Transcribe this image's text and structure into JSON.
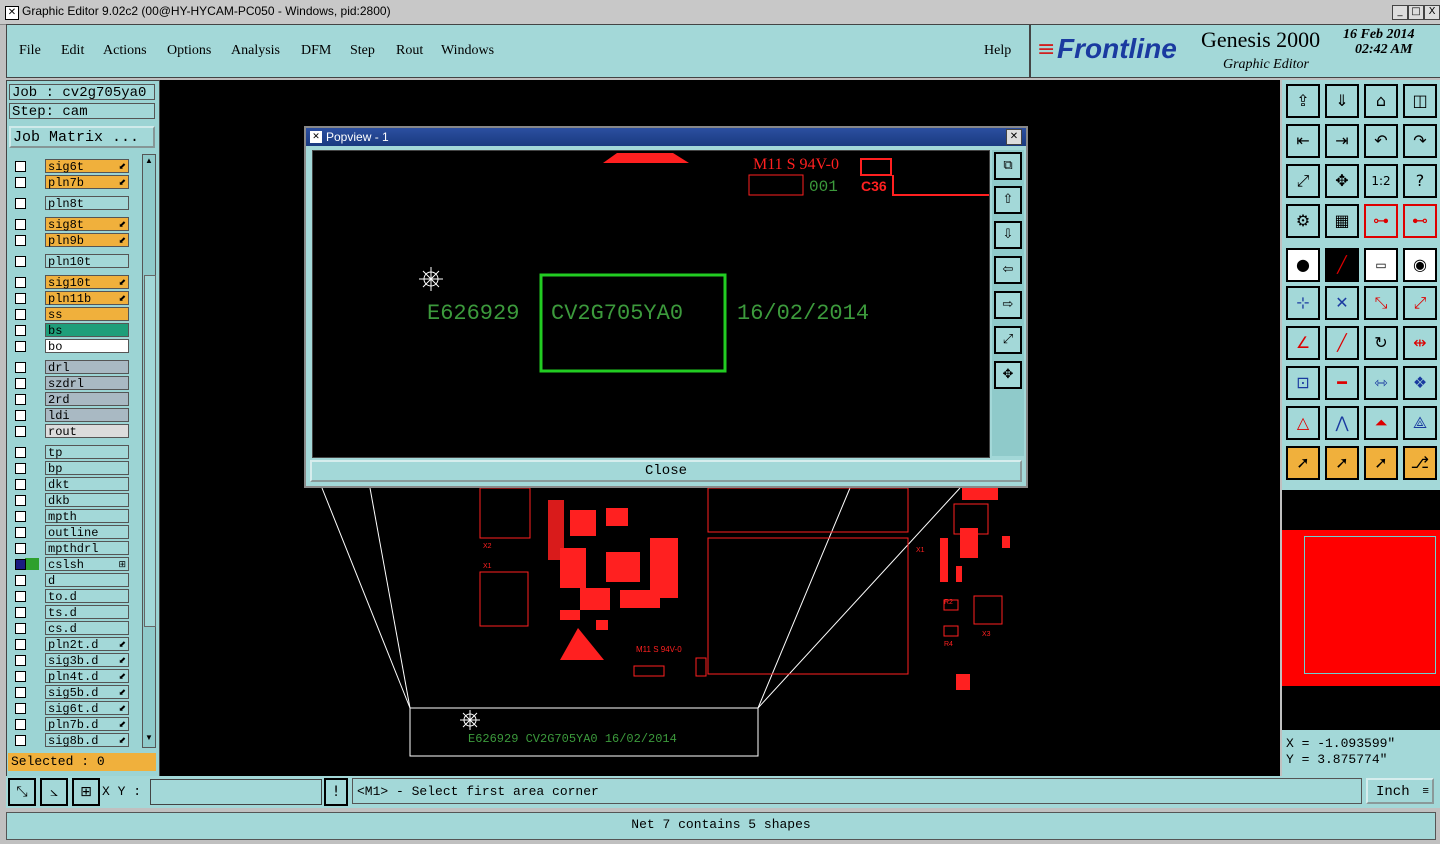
{
  "window": {
    "title": "Graphic Editor 9.02c2 (00@HY-HYCAM-PC050 - Windows, pid:2800)",
    "controls": [
      "_",
      "□",
      "X"
    ]
  },
  "menubar": {
    "items": [
      "File",
      "Edit",
      "Actions",
      "Options",
      "Analysis",
      "DFM",
      "Step",
      "Rout",
      "Windows"
    ],
    "help": "Help"
  },
  "brand": {
    "logo": "Frontline",
    "product": "Genesis 2000",
    "subtitle": "Graphic Editor",
    "date": "16 Feb 2014",
    "time": "02:42 AM"
  },
  "job": {
    "job_label": "Job : cv2g705ya0",
    "step_label": "Step: cam",
    "matrix_button": "Job Matrix ..."
  },
  "layers": [
    {
      "name": "sig6t",
      "color": "#f0b03c",
      "mark": "⬋"
    },
    {
      "name": "pln7b",
      "color": "#f0b03c",
      "mark": "⬋"
    },
    {
      "name": "pln8t",
      "color": "#a3d8d8",
      "mark": ""
    },
    {
      "name": "sig8t",
      "color": "#f0b03c",
      "mark": "⬋"
    },
    {
      "name": "pln9b",
      "color": "#f0b03c",
      "mark": "⬋"
    },
    {
      "name": "pln10t",
      "color": "#a3d8d8",
      "mark": ""
    },
    {
      "name": "sig10t",
      "color": "#f0b03c",
      "mark": "⬋"
    },
    {
      "name": "pln11b",
      "color": "#f0b03c",
      "mark": "⬋"
    },
    {
      "name": "ss",
      "color": "#f0b03c",
      "mark": ""
    },
    {
      "name": "bs",
      "color": "#1e9e7a",
      "mark": ""
    },
    {
      "name": "bo",
      "color": "#ffffff",
      "mark": ""
    },
    {
      "name": "drl",
      "color": "#a9b9c3",
      "mark": ""
    },
    {
      "name": "szdrl",
      "color": "#a9b9c3",
      "mark": ""
    },
    {
      "name": "2rd",
      "color": "#a9b9c3",
      "mark": ""
    },
    {
      "name": "ldi",
      "color": "#a9b9c3",
      "mark": ""
    },
    {
      "name": "rout",
      "color": "#dcdcdc",
      "mark": ""
    },
    {
      "name": "tp",
      "color": "#a3d8d8",
      "mark": ""
    },
    {
      "name": "bp",
      "color": "#a3d8d8",
      "mark": ""
    },
    {
      "name": "dkt",
      "color": "#a3d8d8",
      "mark": ""
    },
    {
      "name": "dkb",
      "color": "#a3d8d8",
      "mark": ""
    },
    {
      "name": "mpth",
      "color": "#a3d8d8",
      "mark": ""
    },
    {
      "name": "outline",
      "color": "#a3d8d8",
      "mark": ""
    },
    {
      "name": "mpthdrl",
      "color": "#a3d8d8",
      "mark": ""
    },
    {
      "name": "cslsh",
      "color": "#a3d8d8",
      "mark": "⊞"
    },
    {
      "name": "d",
      "color": "#a3d8d8",
      "mark": ""
    },
    {
      "name": "to.d",
      "color": "#a3d8d8",
      "mark": ""
    },
    {
      "name": "ts.d",
      "color": "#a3d8d8",
      "mark": ""
    },
    {
      "name": "cs.d",
      "color": "#a3d8d8",
      "mark": ""
    },
    {
      "name": "pln2t.d",
      "color": "#a3d8d8",
      "mark": "⬋"
    },
    {
      "name": "sig3b.d",
      "color": "#a3d8d8",
      "mark": "⬋"
    },
    {
      "name": "pln4t.d",
      "color": "#a3d8d8",
      "mark": "⬋"
    },
    {
      "name": "sig5b.d",
      "color": "#a3d8d8",
      "mark": "⬋"
    },
    {
      "name": "sig6t.d",
      "color": "#a3d8d8",
      "mark": "⬋"
    },
    {
      "name": "pln7b.d",
      "color": "#a3d8d8",
      "mark": "⬋"
    },
    {
      "name": "sig8b.d",
      "color": "#a3d8d8",
      "mark": "⬋"
    }
  ],
  "selected": "Selected : 0",
  "popview": {
    "title": "Popview - 1",
    "close_label": "Close",
    "board_text_left": "E626929",
    "board_text_mid": "CV2G705YA0",
    "board_text_right": "16/02/2014",
    "marking": "M11 S 94V-0",
    "designator": "C36"
  },
  "canvas": {
    "zoom_text": "E626929  CV2G705YA0  16/02/2014",
    "marking_small": "M11 S 94V-0"
  },
  "coords": {
    "x": "X = -1.093599\"",
    "y": "Y = 3.875774\""
  },
  "command": {
    "xy_label": "X Y :",
    "xy_value": "",
    "prompt": "<M1> - Select first area corner",
    "units": "Inch",
    "info_icon": "!"
  },
  "status": "Net 7 contains 5 shapes",
  "colors": {
    "panel": "#a3d8d8",
    "accent_red": "#ff0000",
    "highlight_green": "#22cc22",
    "text_green": "#3c9a3c"
  }
}
